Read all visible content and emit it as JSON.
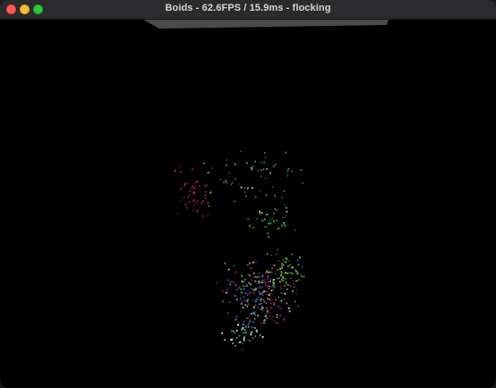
{
  "window": {
    "title": "Boids - 62.6FPS / 15.9ms - flocking"
  },
  "scene": {
    "background": "#000000",
    "plane_color": "#4a4a4a",
    "flock_colors": [
      "#b01a4a",
      "#2aa88a",
      "#38c838",
      "#4858e0",
      "#8a28c8",
      "#d02060",
      "#50b0c0",
      "#c0c040",
      "#e0e0e0",
      "#b0307a",
      "#3070d0",
      "#a0d040"
    ]
  }
}
